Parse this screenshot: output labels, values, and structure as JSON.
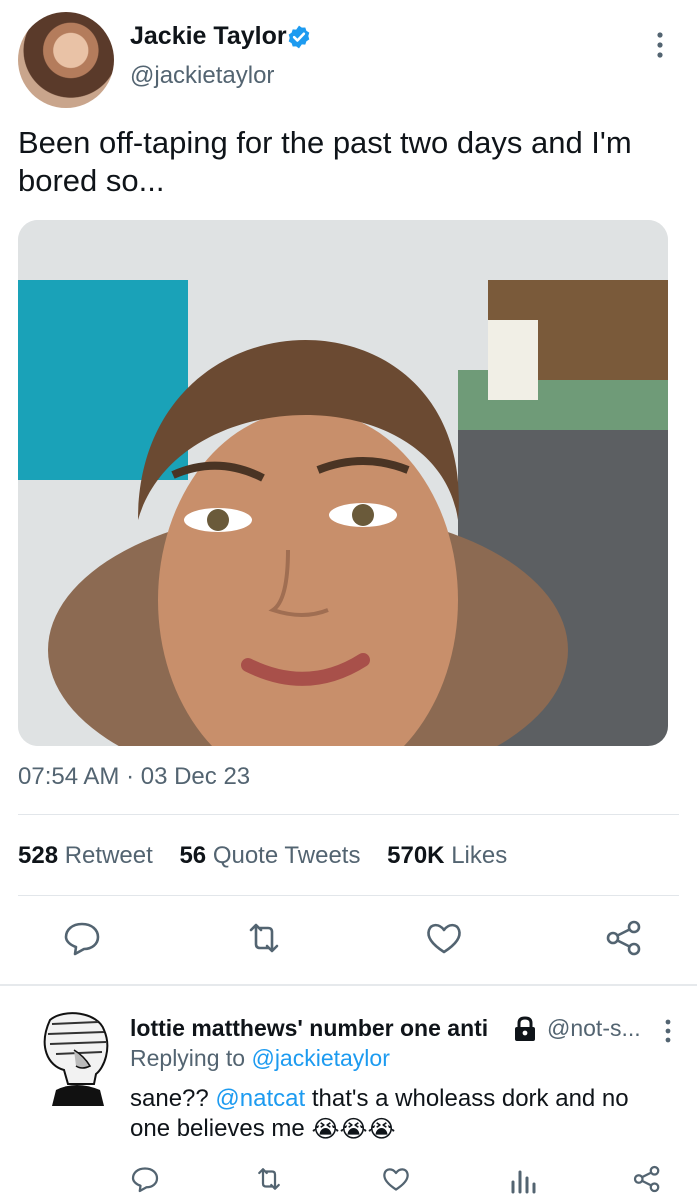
{
  "tweet": {
    "author_name": "Jackie Taylor",
    "author_handle": "@jackietaylor",
    "text": "Been off-taping for the past two days and I'm bored so...",
    "timestamp": "07:54 AM · 03 Dec 23",
    "stats": {
      "retweets_count": "528",
      "retweets_label": "Retweet",
      "quotes_count": "56",
      "quotes_label": "Quote Tweets",
      "likes_count": "570K",
      "likes_label": "Likes"
    }
  },
  "reply": {
    "author_name": "lottie matthews' number one anti",
    "author_handle": "@not-s...",
    "replying_prefix": "Replying to",
    "replying_to": "@jackietaylor",
    "text_before": "sane??",
    "mention": "@natcat",
    "text_after": "that's a wholeass dork and no one believes me",
    "emoji": "😭😭😭"
  },
  "colors": {
    "accent": "#1d9bf0",
    "secondary_text": "#536471",
    "primary_text": "#0f1419"
  },
  "icons": [
    "verified-badge-icon",
    "more-icon",
    "reply-icon",
    "retweet-icon",
    "like-icon",
    "share-icon",
    "lock-icon",
    "views-icon"
  ]
}
